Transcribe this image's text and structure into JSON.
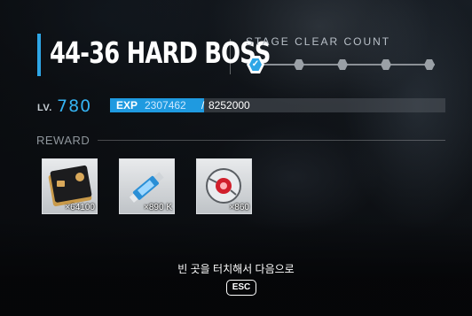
{
  "stage": {
    "title": "44-36 HARD BOSS",
    "clear_count_label": "STAGE CLEAR COUNT",
    "clear_count": 1,
    "clear_count_max": 5
  },
  "level": {
    "label": "LV.",
    "value": "780"
  },
  "exp": {
    "label": "EXP",
    "current": "2307462",
    "separator": "/",
    "max": "8252000",
    "fill_fraction": 0.28
  },
  "reward": {
    "label": "REWARD",
    "items": [
      {
        "icon": "card-icon",
        "quantity": "×64100"
      },
      {
        "icon": "usb-drive-icon",
        "quantity": "×890 K"
      },
      {
        "icon": "core-orb-icon",
        "quantity": "×860"
      }
    ]
  },
  "footer": {
    "hint": "빈 곳을 터치해서 다음으로",
    "esc_label": "ESC"
  },
  "colors": {
    "accent": "#2ea6e6",
    "level": "#35b3f2"
  }
}
